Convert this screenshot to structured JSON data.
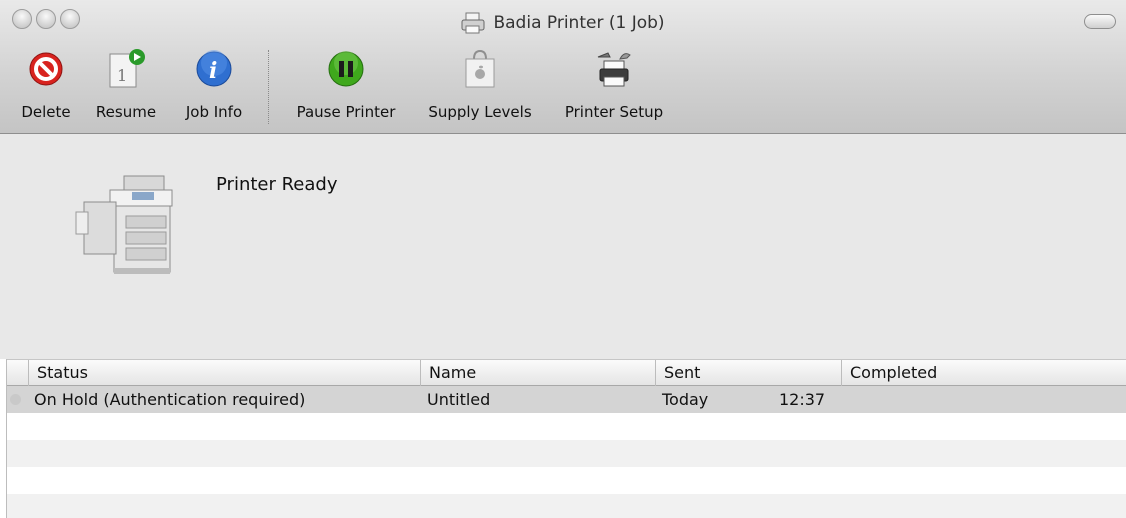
{
  "window": {
    "title": "Badia Printer (1 Job)",
    "title_icon": "printer-proxy-icon"
  },
  "toolbar": {
    "items": [
      {
        "label": "Delete",
        "icon": "delete-icon"
      },
      {
        "label": "Resume",
        "icon": "resume-icon"
      },
      {
        "label": "Job Info",
        "icon": "info-icon"
      },
      {
        "label": "Pause Printer",
        "icon": "pause-icon"
      },
      {
        "label": "Supply Levels",
        "icon": "supply-levels-icon"
      },
      {
        "label": "Printer Setup",
        "icon": "printer-setup-icon"
      }
    ]
  },
  "status": {
    "text": "Printer Ready",
    "image": "printer-image"
  },
  "jobs": {
    "columns": [
      "Status",
      "Name",
      "Sent",
      "Completed"
    ],
    "rows": [
      {
        "status": "On Hold (Authentication required)",
        "name": "Untitled",
        "sent_day": "Today",
        "sent_time": "12:37",
        "completed": ""
      }
    ]
  },
  "colors": {
    "delete_red": "#d8231f",
    "resume_green": "#2a9a2a",
    "info_blue": "#2f6fd0",
    "pause_green": "#3fa81c",
    "selected_row": "#d4d4d4"
  }
}
